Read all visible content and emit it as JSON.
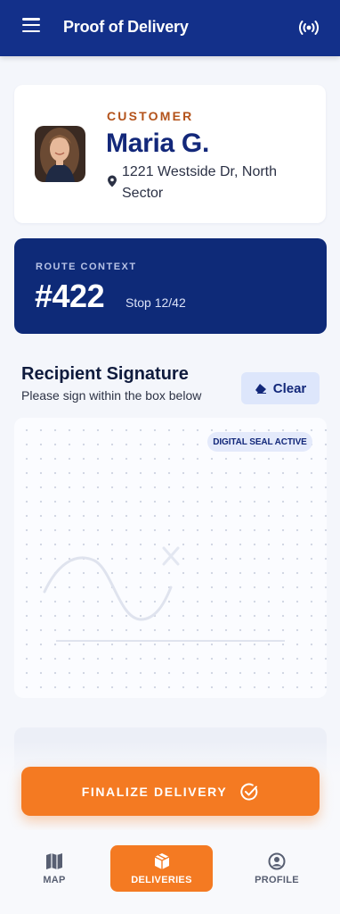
{
  "header": {
    "title": "Proof of Delivery",
    "menu_icon": "menu-icon",
    "signal_icon": "signal-icon"
  },
  "customer": {
    "label": "CUSTOMER",
    "name": "Maria G.",
    "address": "1221 Westside Dr, North Sector",
    "pin_icon": "location-pin-icon"
  },
  "route": {
    "label": "ROUTE CONTEXT",
    "number": "#422",
    "stop": "Stop 12/42"
  },
  "signature": {
    "title": "Recipient Signature",
    "subtitle": "Please sign within the box below",
    "clear_label": "Clear",
    "seal_badge": "DIGITAL SEAL ACTIVE"
  },
  "actions": {
    "finalize_label": "FINALIZE DELIVERY"
  },
  "nav": {
    "items": [
      {
        "label": "MAP",
        "icon": "map-icon"
      },
      {
        "label": "DELIVERIES",
        "icon": "package-icon",
        "active": true
      },
      {
        "label": "PROFILE",
        "icon": "profile-icon"
      }
    ]
  },
  "colors": {
    "primary": "#13308a",
    "route_bg": "#0e2a78",
    "accent": "#f47a22",
    "customer_label": "#b3521a"
  }
}
